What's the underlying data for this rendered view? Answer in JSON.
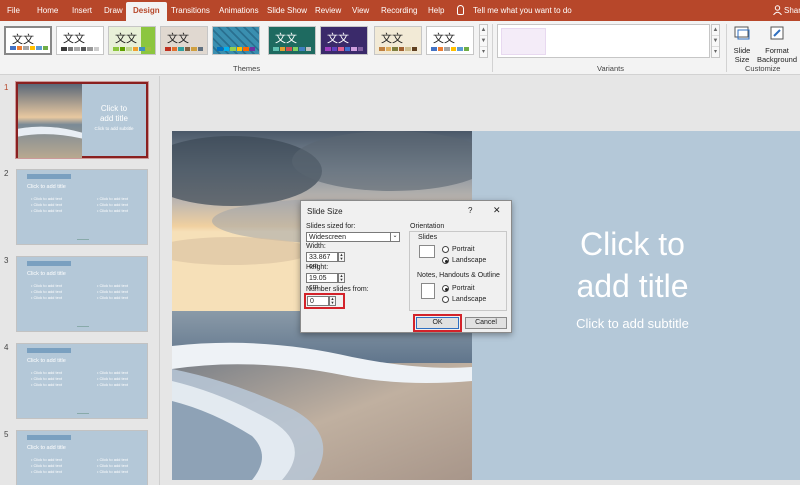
{
  "ribbon": {
    "tabs": [
      "File",
      "Home",
      "Insert",
      "Draw",
      "Design",
      "Transitions",
      "Animations",
      "Slide Show",
      "Review",
      "View",
      "Recording",
      "Help"
    ],
    "active_tab": "Design",
    "tell_me": "Tell me what you want to do",
    "share": "Share",
    "themes_label": "Themes",
    "theme_glyph": "文文",
    "variants_label": "Variants",
    "customize_label": "Customize",
    "slide_size": "Slide\nSize",
    "format_background": "Format\nBackground"
  },
  "colors": {
    "accent": "#b7472a",
    "slide_bg": "#b4c8d8",
    "highlight": "#d3232a"
  },
  "slides": [
    {
      "number": "1",
      "title": "Click to\nadd title",
      "subtitle": "Click to add subtitle"
    },
    {
      "number": "2",
      "title": "Click to add title",
      "bullets": [
        "• Click to add text",
        "• Click to add text",
        "• Click to add text"
      ]
    },
    {
      "number": "3",
      "title": "Click to add title",
      "bullets": [
        "• Click to add text",
        "• Click to add text",
        "• Click to add text"
      ]
    },
    {
      "number": "4",
      "title": "Click to add title",
      "bullets": [
        "• Click to add text",
        "• Click to add text",
        "• Click to add text"
      ]
    },
    {
      "number": "5",
      "title": "Click to add title",
      "bullets": [
        "• Click to add text",
        "• Click to add text",
        "• Click to add text"
      ]
    }
  ],
  "main_slide": {
    "title": "Click to\nadd title",
    "subtitle": "Click to add subtitle"
  },
  "dialog": {
    "title": "Slide Size",
    "help": "?",
    "close": "✕",
    "sized_for_label": "Slides sized for:",
    "sized_for_value": "Widescreen",
    "width_label": "Width:",
    "width_value": "33.867 cm",
    "height_label": "Height:",
    "height_value": "19.05 cm",
    "number_from_label": "Number slides from:",
    "number_from_value": "0",
    "orientation_label": "Orientation",
    "slides_label": "Slides",
    "portrait": "Portrait",
    "landscape": "Landscape",
    "notes_label": "Notes, Handouts & Outline",
    "ok": "OK",
    "cancel": "Cancel"
  }
}
